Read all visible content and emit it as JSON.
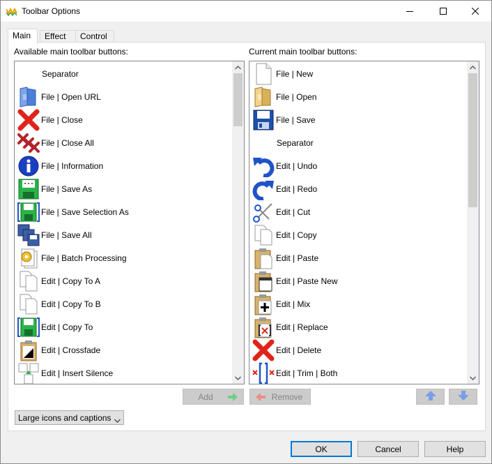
{
  "window": {
    "title": "Toolbar Options"
  },
  "tabs": [
    {
      "label": "Main"
    },
    {
      "label": "Effect"
    },
    {
      "label": "Control"
    }
  ],
  "available": {
    "label": "Available main toolbar buttons:",
    "items": [
      {
        "label": "Separator",
        "icon": "none"
      },
      {
        "label": "File | Open URL",
        "icon": "open-url-icon"
      },
      {
        "label": "File | Close",
        "icon": "close-red-x-icon"
      },
      {
        "label": "File | Close All",
        "icon": "close-all-icon"
      },
      {
        "label": "File | Information",
        "icon": "information-icon"
      },
      {
        "label": "File | Save As",
        "icon": "save-as-icon"
      },
      {
        "label": "File | Save Selection As",
        "icon": "save-selection-icon"
      },
      {
        "label": "File | Save All",
        "icon": "save-all-icon"
      },
      {
        "label": "File | Batch Processing",
        "icon": "batch-processing-icon"
      },
      {
        "label": "Edit | Copy To A",
        "icon": "copy-icon"
      },
      {
        "label": "Edit | Copy To B",
        "icon": "copy-icon"
      },
      {
        "label": "Edit | Copy To",
        "icon": "save-selection-icon"
      },
      {
        "label": "Edit | Crossfade",
        "icon": "crossfade-icon"
      },
      {
        "label": "Edit | Insert Silence",
        "icon": "insert-silence-icon"
      }
    ]
  },
  "current": {
    "label": "Current main toolbar buttons:",
    "items": [
      {
        "label": "File | New",
        "icon": "new-document-icon"
      },
      {
        "label": "File | Open",
        "icon": "open-folder-icon"
      },
      {
        "label": "File | Save",
        "icon": "save-floppy-icon"
      },
      {
        "label": "Separator",
        "icon": "none"
      },
      {
        "label": "Edit | Undo",
        "icon": "undo-icon"
      },
      {
        "label": "Edit | Redo",
        "icon": "redo-icon"
      },
      {
        "label": "Edit | Cut",
        "icon": "scissors-icon"
      },
      {
        "label": "Edit | Copy",
        "icon": "copy-icon"
      },
      {
        "label": "Edit | Paste",
        "icon": "paste-icon"
      },
      {
        "label": "Edit | Paste New",
        "icon": "paste-new-icon"
      },
      {
        "label": "Edit | Mix",
        "icon": "mix-icon"
      },
      {
        "label": "Edit | Replace",
        "icon": "replace-icon"
      },
      {
        "label": "Edit | Delete",
        "icon": "delete-icon"
      },
      {
        "label": "Edit | Trim | Both",
        "icon": "trim-both-icon"
      }
    ]
  },
  "buttons": {
    "add": "Add",
    "remove": "Remove",
    "ok": "OK",
    "cancel": "Cancel",
    "help": "Help"
  },
  "display_mode": {
    "value": "Large icons and captions"
  },
  "colors": {
    "accent": "#0078d7",
    "red": "#e0241b",
    "blue": "#1f53c8",
    "green": "#29b34a"
  }
}
